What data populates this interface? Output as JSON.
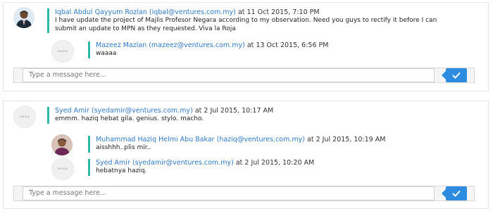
{
  "accent_color": "#2fb8a6",
  "link_color": "#2e79c4",
  "button_color": "#2d8be0",
  "threads": [
    {
      "comment": {
        "author": "Iqbal Abdul Qayyum Rozlan (iqbal@ventures.com.my)",
        "at": "at 11 Oct 2015, 7:10 PM",
        "lines": [
          "I have update the project of Majlis Profesor Negara according to my observation. Need you guys to rectify it before I can",
          "submit an update to MPN as they requested. Viva la Roja"
        ]
      },
      "replies": [
        {
          "author": "Mazeez Mazlan (mazeez@ventures.com.my)",
          "at": "at 13 Oct 2015, 6:56 PM",
          "text": "waaaa"
        }
      ],
      "composer_placeholder": "Type a message here...",
      "send_icon": "check-icon"
    },
    {
      "comment": {
        "author": "Syed Amir (syedamir@ventures.com.my)",
        "at": "at 2 Jul 2015, 10:17 AM",
        "lines": [
          "emmm. haziq hebat gila. genius. stylo. macho."
        ]
      },
      "replies": [
        {
          "author": "Muhammad Haziq Helmi Abu Bakar (haziq@ventures.com.my)",
          "at": "at 2 Jul 2015, 10:19 AM",
          "text": "aisshhh..plis mir.."
        },
        {
          "author": "Syed Amir (syedamir@ventures.com.my)",
          "at": "at 2 Jul 2015, 10:20 AM",
          "text": "hebatnya haziq."
        }
      ],
      "composer_placeholder": "Type a message here...",
      "send_icon": "check-icon"
    }
  ]
}
